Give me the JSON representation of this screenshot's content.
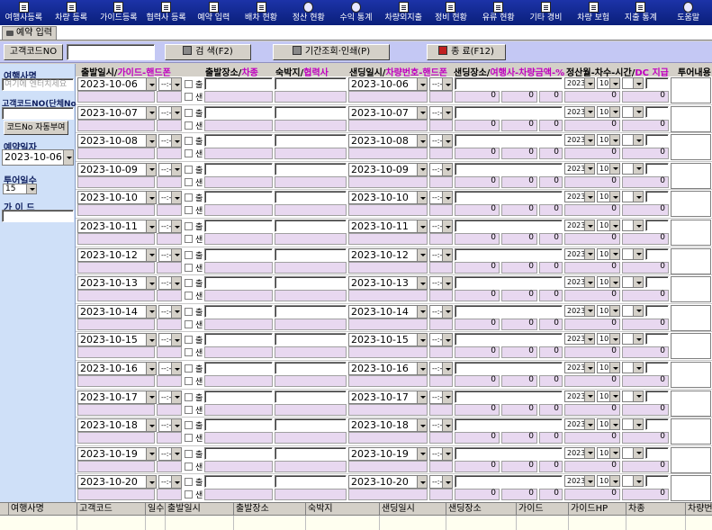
{
  "menu": [
    {
      "label": "여행사등록",
      "icon": "document-icon"
    },
    {
      "label": "차량 등록",
      "icon": "document-icon"
    },
    {
      "label": "가이드등록",
      "icon": "document-icon"
    },
    {
      "label": "협력사 등록",
      "icon": "document-icon"
    },
    {
      "label": "예약 입력",
      "icon": "document-icon"
    },
    {
      "label": "배차 현황",
      "icon": "document-icon"
    },
    {
      "label": "정산 현황",
      "icon": "help-icon"
    },
    {
      "label": "수익 통계",
      "icon": "help-icon"
    },
    {
      "label": "차량외지출",
      "icon": "document-icon"
    },
    {
      "label": "정비 현황",
      "icon": "document-icon"
    },
    {
      "label": "유류 현황",
      "icon": "document-icon"
    },
    {
      "label": "기타 경비",
      "icon": "document-icon"
    },
    {
      "label": "차량 보험",
      "icon": "document-icon"
    },
    {
      "label": "지출 통계",
      "icon": "document-icon"
    },
    {
      "label": "도움말",
      "icon": "help-icon"
    }
  ],
  "tab": {
    "label": "예약 입력"
  },
  "toolbar": {
    "customer_code_label": "고객코드NO",
    "customer_code_value": "",
    "search_label": "검 색(F2)",
    "period_label": "기간조회·인쇄(P)",
    "exit_label": "종  료(F12)"
  },
  "left": {
    "agency_label": "여행사명",
    "agency_placeholder": "여기에 엔터치세요",
    "customer_code_label": "고객코드NO(단체No)",
    "auto_code_button": "코드No 자동부여",
    "date_label": "예약일자",
    "date_value": "2023-10-06",
    "days_label": "투어일수",
    "days_value": "15",
    "guide_label": "가 이 드"
  },
  "headers": {
    "departure": "출발일시/",
    "departure_pink": "가이드-핸드폰",
    "depart_place": "출발장소/",
    "depart_place_pink": "차종",
    "lodging": "숙박지/",
    "lodging_pink": "협력사",
    "sending": "샌딩일시/",
    "sending_pink": "차량번호-핸드폰",
    "send_place": "샌딩장소/",
    "send_place_pink": "여행사-차량금액-%",
    "settle": "정산월-차수-시간/",
    "settle_pink": "DC 지급",
    "tour": "투어내용"
  },
  "row_labels": {
    "out": "출",
    "in": "샌"
  },
  "time_placeholder": "--:--",
  "settle_year": "2023",
  "settle_month": "10",
  "zero": "0",
  "rows": [
    {
      "date": "2023-10-06",
      "send_date": "2023-10-06"
    },
    {
      "date": "2023-10-07",
      "send_date": "2023-10-07"
    },
    {
      "date": "2023-10-08",
      "send_date": "2023-10-08"
    },
    {
      "date": "2023-10-09",
      "send_date": "2023-10-09"
    },
    {
      "date": "2023-10-10",
      "send_date": "2023-10-10"
    },
    {
      "date": "2023-10-11",
      "send_date": "2023-10-11"
    },
    {
      "date": "2023-10-12",
      "send_date": "2023-10-12"
    },
    {
      "date": "2023-10-13",
      "send_date": "2023-10-13"
    },
    {
      "date": "2023-10-14",
      "send_date": "2023-10-14"
    },
    {
      "date": "2023-10-15",
      "send_date": "2023-10-15"
    },
    {
      "date": "2023-10-16",
      "send_date": "2023-10-16"
    },
    {
      "date": "2023-10-17",
      "send_date": "2023-10-17"
    },
    {
      "date": "2023-10-18",
      "send_date": "2023-10-18"
    },
    {
      "date": "2023-10-19",
      "send_date": "2023-10-19"
    },
    {
      "date": "2023-10-20",
      "send_date": "2023-10-20"
    }
  ],
  "bottom_columns": [
    "여행사명",
    "고객코드",
    "일수",
    "출발일시",
    "출발장소",
    "숙박지",
    "샌딩일시",
    "샌딩장소",
    "가이드",
    "가이드HP",
    "차종",
    "차량번"
  ]
}
